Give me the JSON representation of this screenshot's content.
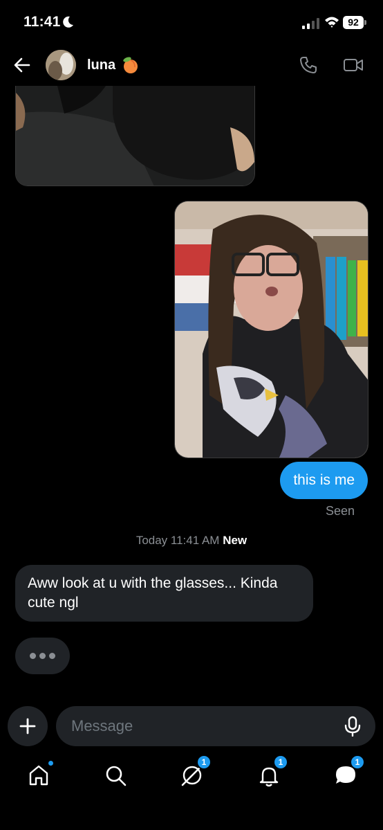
{
  "status_bar": {
    "time": "11:41",
    "battery": "92"
  },
  "header": {
    "contact_name": "luna"
  },
  "messages": {
    "outgoing_text": "this is me",
    "seen_label": "Seen",
    "day_divider": "Today 11:41 AM",
    "new_label": "New",
    "incoming_text": "Aww look at u with the glasses... Kinda cute ngl"
  },
  "composer": {
    "placeholder": "Message"
  },
  "nav": {
    "explore_badge": "1",
    "notifications_badge": "1",
    "messages_badge": "1"
  },
  "colors": {
    "accent": "#1d9bf0",
    "bubble_bg": "#202327",
    "muted_text": "#8b8f94"
  }
}
